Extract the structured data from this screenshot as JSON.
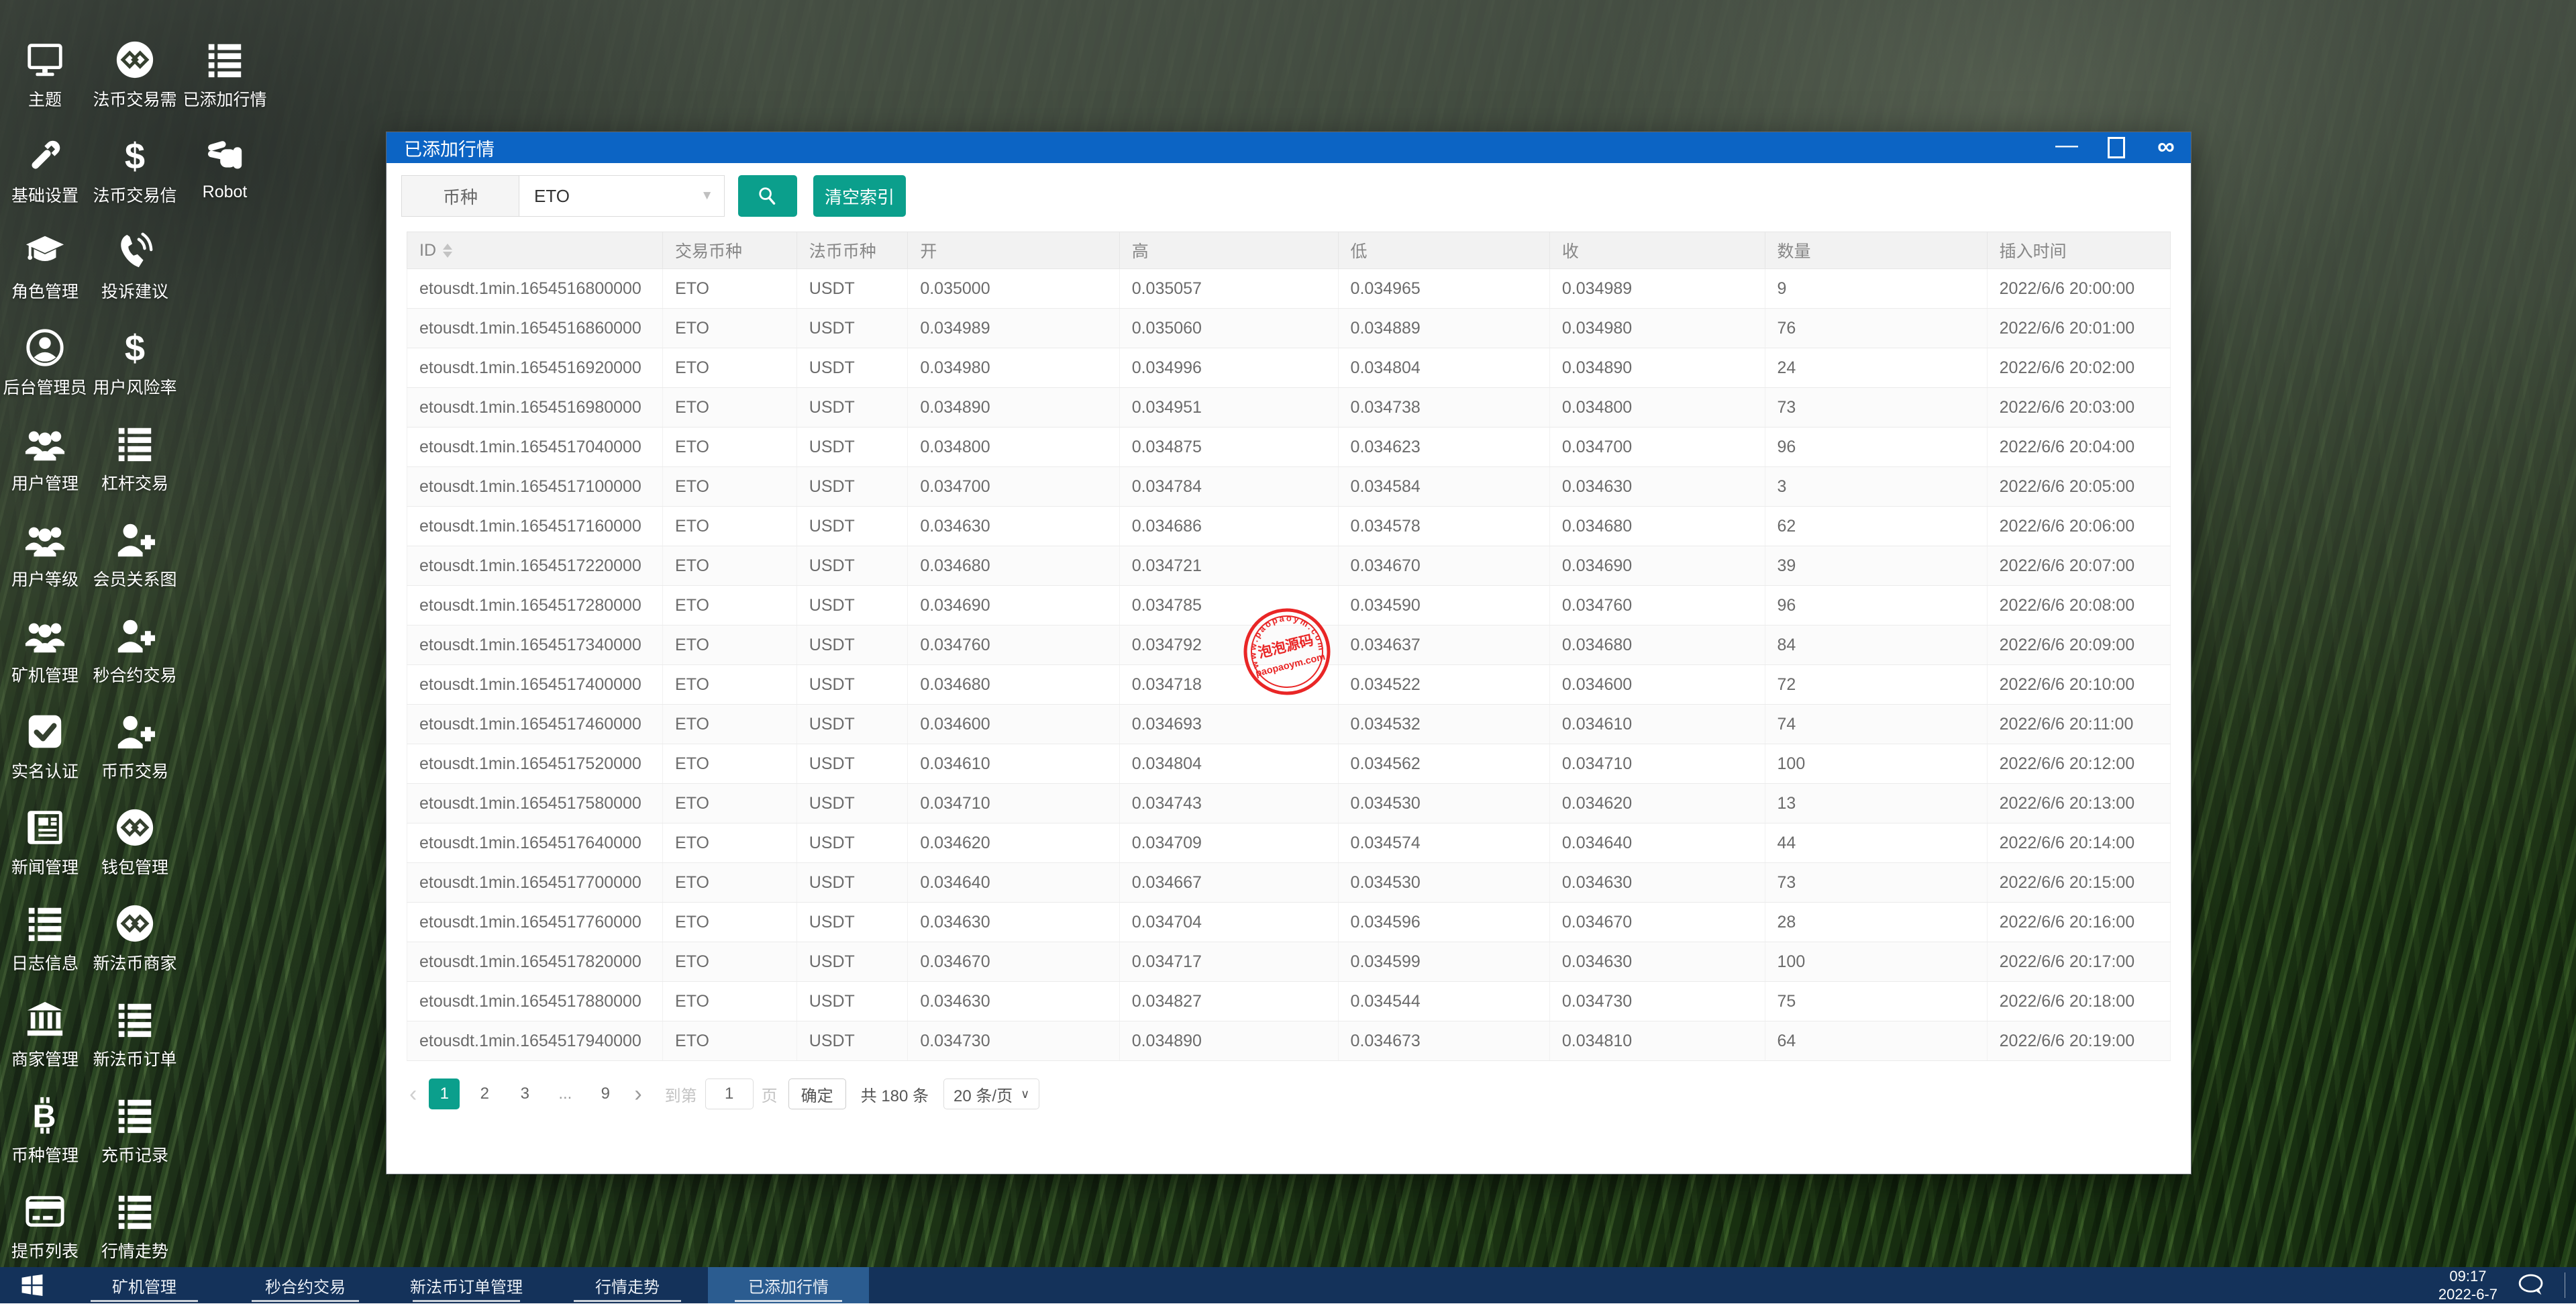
{
  "desktop": {
    "rows": [
      [
        {
          "label": "主题",
          "icon": "monitor-icon"
        },
        {
          "label": "法币交易需",
          "icon": "exchange-logo-icon"
        },
        {
          "label": "已添加行情",
          "icon": "list-icon"
        }
      ],
      [
        {
          "label": "基础设置",
          "icon": "wrench-icon"
        },
        {
          "label": "法币交易信",
          "icon": "dollar-icon"
        },
        {
          "label": "Robot",
          "icon": "hand-scissors-icon"
        }
      ],
      [
        {
          "label": "角色管理",
          "icon": "graduation-cap-icon"
        },
        {
          "label": "投诉建议",
          "icon": "phone-icon"
        }
      ],
      [
        {
          "label": "后台管理员",
          "icon": "user-circle-icon"
        },
        {
          "label": "用户风险率",
          "icon": "dollar-icon"
        }
      ],
      [
        {
          "label": "用户管理",
          "icon": "users-icon"
        },
        {
          "label": "杠杆交易",
          "icon": "list-icon"
        }
      ],
      [
        {
          "label": "用户等级",
          "icon": "users-icon"
        },
        {
          "label": "会员关系图",
          "icon": "user-plus-icon"
        }
      ],
      [
        {
          "label": "矿机管理",
          "icon": "users-icon"
        },
        {
          "label": "秒合约交易",
          "icon": "user-plus-icon"
        }
      ],
      [
        {
          "label": "实名认证",
          "icon": "check-square-icon"
        },
        {
          "label": "币币交易",
          "icon": "user-plus-icon"
        }
      ],
      [
        {
          "label": "新闻管理",
          "icon": "newspaper-icon"
        },
        {
          "label": "钱包管理",
          "icon": "exchange-logo-icon"
        }
      ],
      [
        {
          "label": "日志信息",
          "icon": "list-icon"
        },
        {
          "label": "新法币商家",
          "icon": "exchange-logo-icon"
        }
      ],
      [
        {
          "label": "商家管理",
          "icon": "bank-icon"
        },
        {
          "label": "新法币订单",
          "icon": "list-icon"
        }
      ],
      [
        {
          "label": "币种管理",
          "icon": "bitcoin-icon"
        },
        {
          "label": "充币记录",
          "icon": "list-icon"
        }
      ],
      [
        {
          "label": "提币列表",
          "icon": "credit-card-icon"
        },
        {
          "label": "行情走势",
          "icon": "list-icon"
        }
      ]
    ]
  },
  "window": {
    "title": "已添加行情",
    "controls": {
      "minimize": "—",
      "infinity": "∞"
    },
    "filter": {
      "field_label": "币种",
      "select_value": "ETO",
      "caret": "▼",
      "clear_button": "清空索引"
    },
    "table": {
      "columns": [
        "ID",
        "交易币种",
        "法币币种",
        "开",
        "高",
        "低",
        "收",
        "数量",
        "插入时间"
      ],
      "rows": [
        [
          "etousdt.1min.1654516800000",
          "ETO",
          "USDT",
          "0.035000",
          "0.035057",
          "0.034965",
          "0.034989",
          "9",
          "2022/6/6 20:00:00"
        ],
        [
          "etousdt.1min.1654516860000",
          "ETO",
          "USDT",
          "0.034989",
          "0.035060",
          "0.034889",
          "0.034980",
          "76",
          "2022/6/6 20:01:00"
        ],
        [
          "etousdt.1min.1654516920000",
          "ETO",
          "USDT",
          "0.034980",
          "0.034996",
          "0.034804",
          "0.034890",
          "24",
          "2022/6/6 20:02:00"
        ],
        [
          "etousdt.1min.1654516980000",
          "ETO",
          "USDT",
          "0.034890",
          "0.034951",
          "0.034738",
          "0.034800",
          "73",
          "2022/6/6 20:03:00"
        ],
        [
          "etousdt.1min.1654517040000",
          "ETO",
          "USDT",
          "0.034800",
          "0.034875",
          "0.034623",
          "0.034700",
          "96",
          "2022/6/6 20:04:00"
        ],
        [
          "etousdt.1min.1654517100000",
          "ETO",
          "USDT",
          "0.034700",
          "0.034784",
          "0.034584",
          "0.034630",
          "3",
          "2022/6/6 20:05:00"
        ],
        [
          "etousdt.1min.1654517160000",
          "ETO",
          "USDT",
          "0.034630",
          "0.034686",
          "0.034578",
          "0.034680",
          "62",
          "2022/6/6 20:06:00"
        ],
        [
          "etousdt.1min.1654517220000",
          "ETO",
          "USDT",
          "0.034680",
          "0.034721",
          "0.034670",
          "0.034690",
          "39",
          "2022/6/6 20:07:00"
        ],
        [
          "etousdt.1min.1654517280000",
          "ETO",
          "USDT",
          "0.034690",
          "0.034785",
          "0.034590",
          "0.034760",
          "96",
          "2022/6/6 20:08:00"
        ],
        [
          "etousdt.1min.1654517340000",
          "ETO",
          "USDT",
          "0.034760",
          "0.034792",
          "0.034637",
          "0.034680",
          "84",
          "2022/6/6 20:09:00"
        ],
        [
          "etousdt.1min.1654517400000",
          "ETO",
          "USDT",
          "0.034680",
          "0.034718",
          "0.034522",
          "0.034600",
          "72",
          "2022/6/6 20:10:00"
        ],
        [
          "etousdt.1min.1654517460000",
          "ETO",
          "USDT",
          "0.034600",
          "0.034693",
          "0.034532",
          "0.034610",
          "74",
          "2022/6/6 20:11:00"
        ],
        [
          "etousdt.1min.1654517520000",
          "ETO",
          "USDT",
          "0.034610",
          "0.034804",
          "0.034562",
          "0.034710",
          "100",
          "2022/6/6 20:12:00"
        ],
        [
          "etousdt.1min.1654517580000",
          "ETO",
          "USDT",
          "0.034710",
          "0.034743",
          "0.034530",
          "0.034620",
          "13",
          "2022/6/6 20:13:00"
        ],
        [
          "etousdt.1min.1654517640000",
          "ETO",
          "USDT",
          "0.034620",
          "0.034709",
          "0.034574",
          "0.034640",
          "44",
          "2022/6/6 20:14:00"
        ],
        [
          "etousdt.1min.1654517700000",
          "ETO",
          "USDT",
          "0.034640",
          "0.034667",
          "0.034530",
          "0.034630",
          "73",
          "2022/6/6 20:15:00"
        ],
        [
          "etousdt.1min.1654517760000",
          "ETO",
          "USDT",
          "0.034630",
          "0.034704",
          "0.034596",
          "0.034670",
          "28",
          "2022/6/6 20:16:00"
        ],
        [
          "etousdt.1min.1654517820000",
          "ETO",
          "USDT",
          "0.034670",
          "0.034717",
          "0.034599",
          "0.034630",
          "100",
          "2022/6/6 20:17:00"
        ],
        [
          "etousdt.1min.1654517880000",
          "ETO",
          "USDT",
          "0.034630",
          "0.034827",
          "0.034544",
          "0.034730",
          "75",
          "2022/6/6 20:18:00"
        ],
        [
          "etousdt.1min.1654517940000",
          "ETO",
          "USDT",
          "0.034730",
          "0.034890",
          "0.034673",
          "0.034810",
          "64",
          "2022/6/6 20:19:00"
        ]
      ]
    },
    "pagination": {
      "prev": "‹",
      "pages": [
        {
          "label": "1",
          "active": true
        },
        {
          "label": "2",
          "active": false
        },
        {
          "label": "3",
          "active": false
        },
        {
          "label": "...",
          "active": false,
          "dots": true
        },
        {
          "label": "9",
          "active": false
        }
      ],
      "next": "›",
      "goto_label": "到第",
      "goto_value": "1",
      "page_unit": "页",
      "confirm": "确定",
      "total": "共 180 条",
      "per_page": "20 条/页",
      "per_page_caret": "∨"
    }
  },
  "stamp": {
    "arc_text": "www.paopaoym.com",
    "line1": "泡泡源码",
    "line2": "paopaoym.com",
    "color": "#e81414"
  },
  "taskbar": {
    "items": [
      {
        "label": "矿机管理",
        "active": false
      },
      {
        "label": "秒合约交易",
        "active": false
      },
      {
        "label": "新法币订单管理",
        "active": false
      },
      {
        "label": "行情走势",
        "active": false
      },
      {
        "label": "已添加行情",
        "active": true
      }
    ],
    "clock_time": "09:17",
    "clock_date": "2022-6-7"
  },
  "colors": {
    "titlebar_blue": "#0c64c4",
    "accent_teal": "#0b9f8c",
    "taskbar_navy": "#14325a",
    "taskbar_active": "#2b5c90",
    "stamp_red": "#e81414"
  }
}
